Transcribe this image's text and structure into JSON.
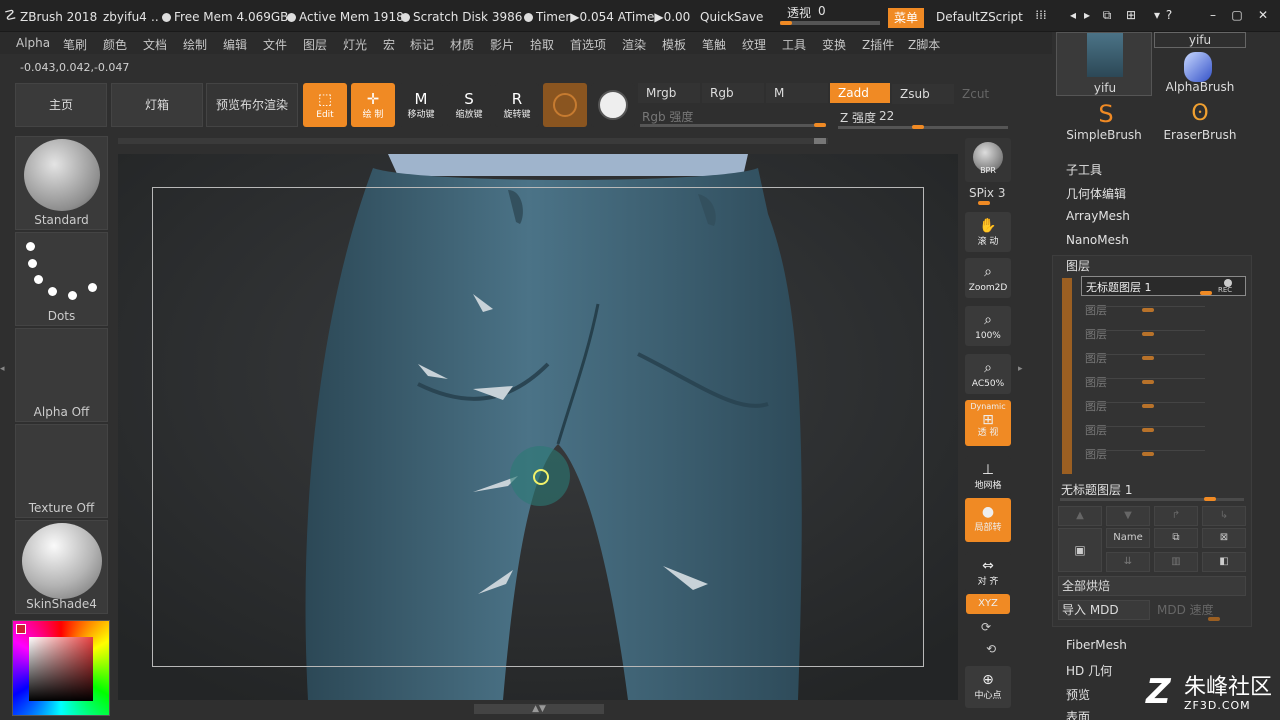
{
  "titlebar": {
    "app": "ZBrush 2018",
    "file": "zbyifu4",
    "ellipsis": "..",
    "free_mem": "Free Mem 4.069GB",
    "active_mem": "Active Mem 1918",
    "scratch": "Scratch Disk 3986",
    "timer": "Timer▶0.054 ATime▶0.00",
    "quicksave": "QuickSave",
    "transparency_label": "透视",
    "transparency_value": "0",
    "menu_btn": "菜单",
    "script": "DefaultZScript"
  },
  "menubar": [
    "Alpha",
    "笔刷",
    "颜色",
    "文档",
    "绘制",
    "编辑",
    "文件",
    "图层",
    "灯光",
    "宏",
    "标记",
    "材质",
    "影片",
    "拾取",
    "首选项",
    "渲染",
    "模板",
    "笔触",
    "纹理",
    "工具",
    "变换",
    "Z插件",
    "Z脚本"
  ],
  "coords": "-0.043,0.042,-0.047",
  "shelf": {
    "home": "主页",
    "lightbox": "灯箱",
    "bpr_preview": "预览布尔渲染"
  },
  "tools": {
    "edit": "Edit",
    "draw": "绘 制",
    "move": "移动键",
    "scale": "缩放键",
    "rotate": "旋转键",
    "move_glyph": "M",
    "scale_glyph": "S",
    "rotate_glyph": "R"
  },
  "color_modes": {
    "mrgb": "Mrgb",
    "rgb": "Rgb",
    "m": "M",
    "zadd": "Zadd",
    "zsub": "Zsub",
    "zcut": "Zcut",
    "rgb_intensity": "Rgb 强度",
    "z_intensity_label": "Z 强度",
    "z_intensity_value": "22"
  },
  "left_panels": {
    "brush": "Standard",
    "stroke": "Dots",
    "alpha": "Alpha Off",
    "texture": "Texture Off",
    "material": "SkinShade4"
  },
  "right_tools": {
    "bpr": "BPR",
    "spix": "SPix 3",
    "scroll": "滚 动",
    "zoom2d": "Zoom2D",
    "p100": "100%",
    "ac50": "AC50%",
    "dynamic": "Dynamic",
    "persp": "透 视",
    "floor": "地网格",
    "local": "局部转",
    "frame": "对 齐",
    "xyz": "XYZ",
    "center": "中心点"
  },
  "tool_palette": {
    "subtool_name": "yifu",
    "thumb_name": "yifu",
    "alphabrush": "AlphaBrush",
    "simplebrush": "SimpleBrush",
    "eraserbrush": "EraserBrush"
  },
  "tool_menu": [
    "子工具",
    "几何体编辑",
    "ArrayMesh",
    "NanoMesh"
  ],
  "layers": {
    "title": "图层",
    "active": "无标题图层 1",
    "rec": "REC",
    "rows": [
      "图层",
      "图层",
      "图层",
      "图层",
      "图层",
      "图层",
      "图层"
    ],
    "current_label": "无标题图层 1",
    "name_btn": "Name",
    "bake_all": "全部烘焙",
    "import_mdd": "导入 MDD",
    "mdd_speed": "MDD 速度"
  },
  "tool_menu_bottom": [
    "FiberMesh",
    "HD 几何",
    "预览",
    "表面"
  ],
  "watermark": {
    "logo": "Z",
    "title": "朱峰社区",
    "url": "ZF3D.COM"
  },
  "colors": {
    "accent": "#f08a24",
    "bg": "#2f2f2f",
    "panel": "#3a3a3a",
    "fabric": "#3d6175"
  }
}
